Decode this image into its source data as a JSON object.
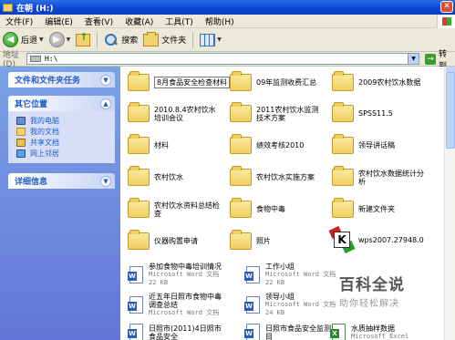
{
  "window": {
    "title": "在朝 (H:)"
  },
  "menu": [
    "文件(F)",
    "编辑(E)",
    "查看(V)",
    "收藏(A)",
    "工具(T)",
    "帮助(H)"
  ],
  "toolbar": {
    "back": "后退",
    "search": "搜索",
    "folders": "文件夹"
  },
  "address": {
    "label": "地址(D)",
    "value": "H:\\",
    "go": "转到"
  },
  "sidebar": {
    "tasks_title": "文件和文件夹任务",
    "places_title": "其它位置",
    "places": [
      "我的电脑",
      "我的文档",
      "共享文档",
      "网上邻居"
    ],
    "details_title": "详细信息"
  },
  "folders": [
    "8月食品安全检查材料",
    "09年监测收费汇总",
    "2009农村饮水数据",
    "2010.8.4农村饮水培训会议",
    "2011农村饮水监测技术方案",
    "SPSS11.5",
    "材料",
    "绩效考核2010",
    "领导讲话稿",
    "农村饮水",
    "农村饮水实施方案",
    "农村饮水数据统计分析",
    "农村饮水资料总结检查",
    "食物中毒",
    "新建文件夹",
    "仪器购置申请",
    "照片"
  ],
  "app_item": {
    "label": "wps2007.27948.0"
  },
  "docs": [
    {
      "name": "参加食物中毒培训情况",
      "type": "Microsoft Word 文档",
      "size": "22 KB"
    },
    {
      "name": "工作小组",
      "type": "Microsoft Word 文档",
      "size": "22 KB"
    },
    {
      "name": "近五年日照市食物中毒调查总结",
      "type": "Microsoft Word 文档",
      "size": ""
    },
    {
      "name": "领导小组",
      "type": "Microsoft Word 文档",
      "size": "24 KB"
    },
    {
      "name": "日照市(2011)4日照市食品安全",
      "type": "",
      "size": ""
    },
    {
      "name": "日照市食品安全监测项目",
      "type": "",
      "size": ""
    },
    {
      "name": "水质抽样数据",
      "type": "Microsoft Excel",
      "size": ""
    }
  ],
  "watermark": {
    "title": "百科全说",
    "subtitle": "助你轻松解决"
  }
}
